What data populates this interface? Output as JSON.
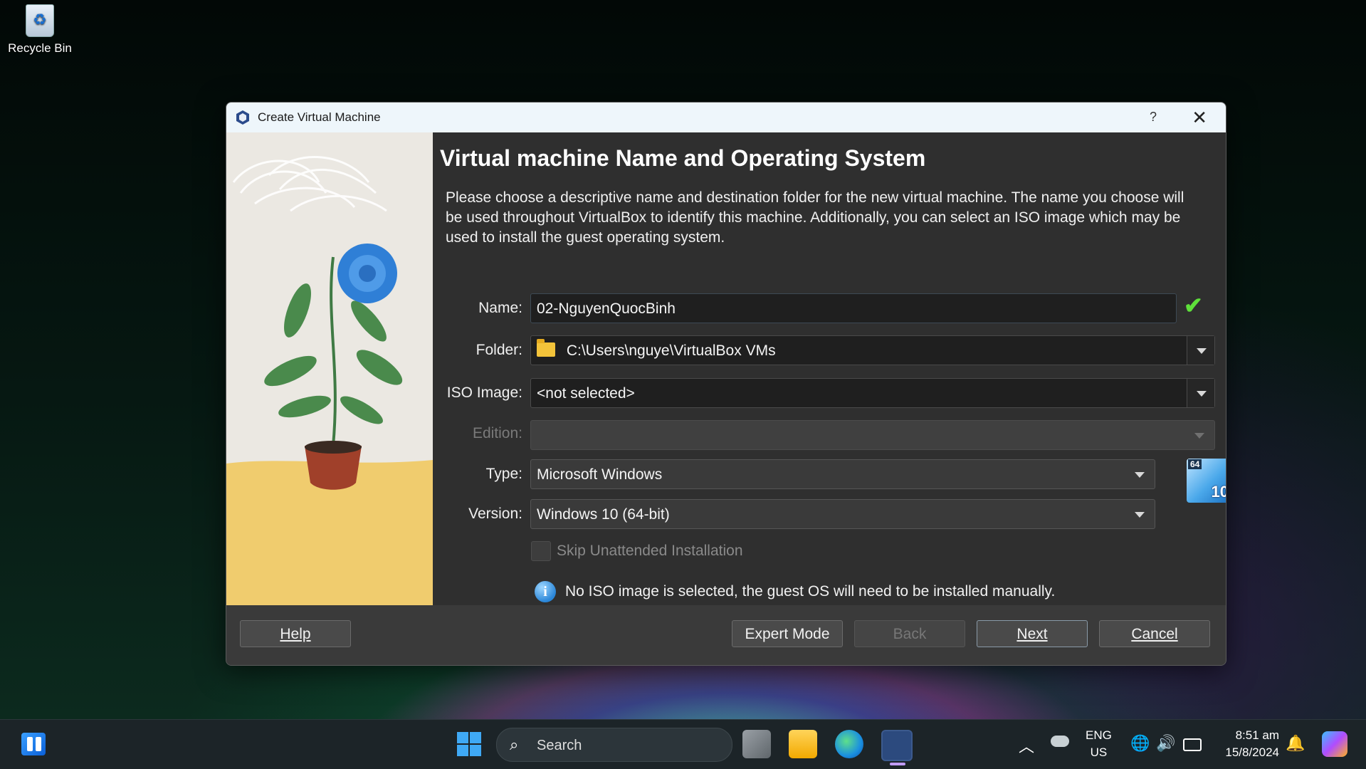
{
  "desktop": {
    "recycle_bin_label": "Recycle Bin"
  },
  "dialog": {
    "title": "Create Virtual Machine",
    "help_glyph": "?",
    "close_glyph": "✕",
    "heading": "Virtual machine Name and Operating System",
    "description": "Please choose a descriptive name and destination folder for the new virtual machine. The name you choose will be used throughout VirtualBox to identify this machine. Additionally, you can select an ISO image which may be used to install the guest operating system.",
    "fields": {
      "name_label": "Name:",
      "name_value": "02-NguyenQuocBinh",
      "folder_label": "Folder:",
      "folder_value": "C:\\Users\\nguye\\VirtualBox VMs",
      "iso_label": "ISO Image:",
      "iso_value": "<not selected>",
      "edition_label": "Edition:",
      "edition_value": "",
      "type_label": "Type:",
      "type_value": "Microsoft Windows",
      "version_label": "Version:",
      "version_value": "Windows 10 (64-bit)"
    },
    "os_badge": {
      "bits": "64",
      "version": "10"
    },
    "skip_unattended_label": "Skip Unattended Installation",
    "info_message": "No ISO image is selected, the guest OS will need to be installed manually.",
    "buttons": {
      "help": "Help",
      "expert_mode": "Expert Mode",
      "back": "Back",
      "next": "Next",
      "cancel": "Cancel"
    }
  },
  "taskbar": {
    "search_label": "Search",
    "language_line1": "ENG",
    "language_line2": "US",
    "time": "8:51 am",
    "date": "15/8/2024"
  },
  "colors": {
    "dialog_bg": "#3a3a3a",
    "content_bg": "#2f2f2f",
    "titlebar_bg": "#eef6fb",
    "accent_check": "#5ee03a",
    "taskbar_bg": "#1c2428"
  }
}
